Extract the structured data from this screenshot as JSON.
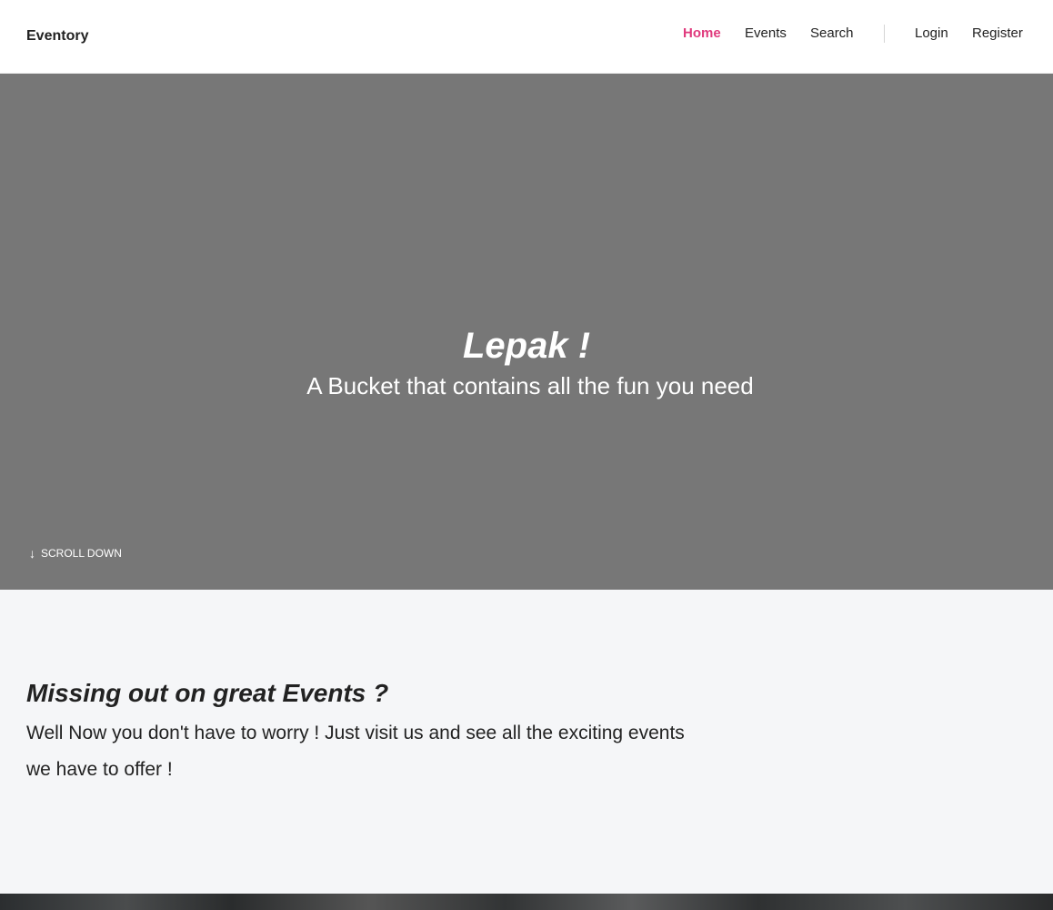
{
  "navbar": {
    "brand": "Eventory",
    "links": [
      {
        "label": "Home",
        "active": true
      },
      {
        "label": "Events",
        "active": false
      },
      {
        "label": "Search",
        "active": false
      }
    ],
    "auth": [
      {
        "label": "Login"
      },
      {
        "label": "Register"
      }
    ],
    "accent_color": "#e03a7d"
  },
  "hero": {
    "title": "Lepak !",
    "subtitle": "A Bucket that contains all the fun you need",
    "scroll_icon": "arrow-down-icon",
    "scroll_label": "SCROLL DOWN",
    "background_color": "#777777"
  },
  "intro": {
    "title": "Missing out on great Events ?",
    "body": "Well Now you don't have to worry ! Just visit us and see all the exciting events we have to offer !"
  }
}
